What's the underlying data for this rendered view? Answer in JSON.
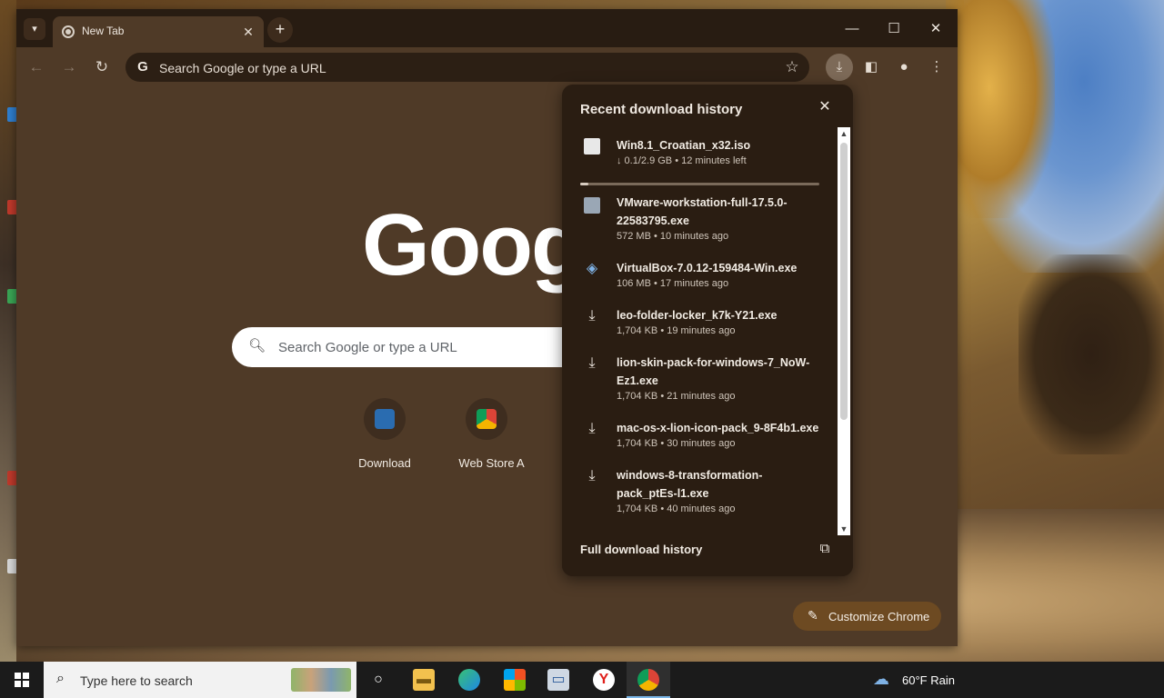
{
  "browser": {
    "tab": {
      "title": "New Tab"
    },
    "window_controls": {
      "minimize": "—",
      "maximize": "☐",
      "close": "✕"
    },
    "omnibox": {
      "placeholder": "Search Google or type a URL"
    }
  },
  "ntp": {
    "logo_text": "Google",
    "search_placeholder": "Search Google or type a URL",
    "shortcuts": [
      {
        "label": "Download"
      },
      {
        "label": "Web Store"
      },
      {
        "label": "A"
      }
    ],
    "customize_label": "Customize Chrome"
  },
  "downloads": {
    "title": "Recent download history",
    "items": [
      {
        "name": "Win8.1_Croatian_x32.iso",
        "meta": "↓ 0.1/2.9 GB • 12 minutes left",
        "progress": 0.034
      },
      {
        "name": "VMware-workstation-full-17.5.0-22583795.exe",
        "meta": "572 MB • 10 minutes ago"
      },
      {
        "name": "VirtualBox-7.0.12-159484-Win.exe",
        "meta": "106 MB • 17 minutes ago"
      },
      {
        "name": "leo-folder-locker_k7k-Y21.exe",
        "meta": "1,704 KB • 19 minutes ago"
      },
      {
        "name": "lion-skin-pack-for-windows-7_NoW-Ez1.exe",
        "meta": "1,704 KB • 21 minutes ago"
      },
      {
        "name": "mac-os-x-lion-icon-pack_9-8F4b1.exe",
        "meta": "1,704 KB • 30 minutes ago"
      },
      {
        "name": "windows-8-transformation-pack_ptEs-l1.exe",
        "meta": "1,704 KB • 40 minutes ago"
      }
    ],
    "footer_label": "Full download history"
  },
  "taskbar": {
    "search_placeholder": "Type here to search",
    "weather": "60°F  Rain"
  },
  "colors": {
    "toolbar": "#4f3a27",
    "tabstrip": "#281c12",
    "panel": "#2a1d12",
    "accent": "#6d4a22"
  }
}
